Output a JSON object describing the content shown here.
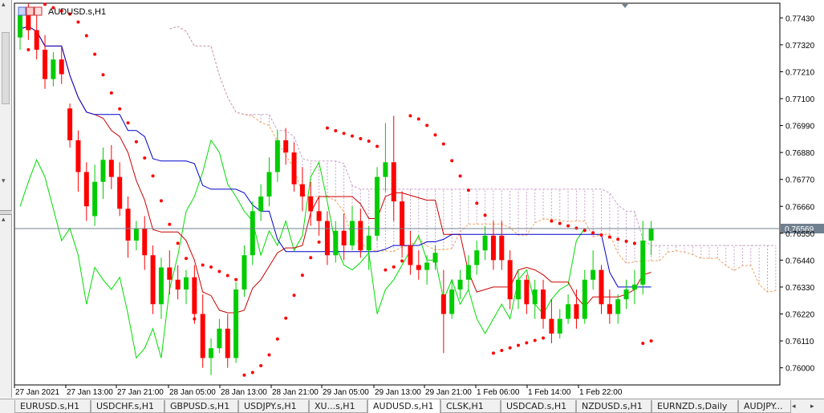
{
  "window": {
    "title": "AUDUSD.s,H1",
    "current_price": "0.76569",
    "marker_icon": "triangle-down-icon"
  },
  "colors": {
    "bull": "#00cc00",
    "bear": "#ff0000",
    "tenkan": "#cc0000",
    "kijun": "#0000cc",
    "chikou": "#00dd00",
    "span_a": "#f4a460",
    "span_b": "#c8a2c8",
    "psar": "#ff0000",
    "price_line": "#708090"
  },
  "price_axis": {
    "labels": [
      "0.77430",
      "0.77320",
      "0.77210",
      "0.77100",
      "0.76990",
      "0.76880",
      "0.76770",
      "0.76660",
      "0.76550",
      "0.76440",
      "0.76330",
      "0.76220",
      "0.76110",
      "0.76000"
    ]
  },
  "time_axis": {
    "labels": [
      "27 Jan 2021",
      "27 Jan 13:00",
      "27 Jan 21:00",
      "28 Jan 05:00",
      "28 Jan 13:00",
      "28 Jan 21:00",
      "29 Jan 05:00",
      "29 Jan 13:00",
      "29 Jan 21:00",
      "1 Feb 06:00",
      "1 Feb 14:00",
      "1 Feb 22:00"
    ]
  },
  "tabs": [
    {
      "label": "EURUSD.s,H1"
    },
    {
      "label": "USDCHF.s,H1"
    },
    {
      "label": "GBPUSD.s,H1"
    },
    {
      "label": "USDJPY.s,H1"
    },
    {
      "label": "XU...s,H1"
    },
    {
      "label": "AUDUSD.s,H1"
    },
    {
      "label": "CLSK,H1"
    },
    {
      "label": "USDCAD.s,H1"
    },
    {
      "label": "NZDUSD.s,H1"
    },
    {
      "label": "EURNZD.s,Daily"
    },
    {
      "label": "AUDJPY..."
    }
  ],
  "tab_nav": {
    "left": "◂",
    "right": "▸"
  },
  "chart_data": {
    "type": "candlestick",
    "symbol": "AUDUSD.s",
    "timeframe": "H1",
    "ylim": [
      0.7593,
      0.7749
    ],
    "last_price": 0.76569,
    "x_labels": [
      "27 Jan 2021",
      "27 Jan 13:00",
      "27 Jan 21:00",
      "28 Jan 05:00",
      "28 Jan 13:00",
      "28 Jan 21:00",
      "29 Jan 05:00",
      "29 Jan 13:00",
      "29 Jan 21:00",
      "1 Feb 06:00",
      "1 Feb 14:00",
      "1 Feb 22:00"
    ],
    "candles": [
      [
        0.7735,
        0.7747,
        0.773,
        0.7744
      ],
      [
        0.7744,
        0.7749,
        0.7734,
        0.7738
      ],
      [
        0.7738,
        0.7746,
        0.7726,
        0.773
      ],
      [
        0.773,
        0.7736,
        0.7714,
        0.7718
      ],
      [
        0.7718,
        0.7729,
        0.7715,
        0.7726
      ],
      [
        0.7726,
        0.7731,
        0.7716,
        0.772
      ],
      [
        0.7706,
        0.7708,
        0.769,
        0.7693
      ],
      [
        0.7693,
        0.7697,
        0.7672,
        0.768
      ],
      [
        0.768,
        0.7684,
        0.766,
        0.7666
      ],
      [
        0.7662,
        0.7683,
        0.7658,
        0.7676
      ],
      [
        0.7676,
        0.769,
        0.7669,
        0.7685
      ],
      [
        0.7685,
        0.7691,
        0.7673,
        0.7678
      ],
      [
        0.7678,
        0.7684,
        0.7662,
        0.7665
      ],
      [
        0.7665,
        0.767,
        0.7645,
        0.7652
      ],
      [
        0.7652,
        0.766,
        0.7648,
        0.7657
      ],
      [
        0.7657,
        0.7662,
        0.764,
        0.7646
      ],
      [
        0.7646,
        0.765,
        0.7622,
        0.7626
      ],
      [
        0.7626,
        0.7645,
        0.762,
        0.7641
      ],
      [
        0.7641,
        0.7648,
        0.763,
        0.7636
      ],
      [
        0.7636,
        0.7642,
        0.7628,
        0.7632
      ],
      [
        0.7632,
        0.764,
        0.7626,
        0.7637
      ],
      [
        0.7637,
        0.7642,
        0.7618,
        0.7622
      ],
      [
        0.7622,
        0.763,
        0.76,
        0.7604
      ],
      [
        0.7604,
        0.7612,
        0.7597,
        0.7608
      ],
      [
        0.7608,
        0.762,
        0.7606,
        0.7616
      ],
      [
        0.7616,
        0.7622,
        0.76,
        0.7604
      ],
      [
        0.7604,
        0.7635,
        0.7602,
        0.7632
      ],
      [
        0.7632,
        0.765,
        0.7629,
        0.7646
      ],
      [
        0.7646,
        0.7668,
        0.7642,
        0.7664
      ],
      [
        0.7664,
        0.7675,
        0.766,
        0.767
      ],
      [
        0.767,
        0.7686,
        0.7666,
        0.768
      ],
      [
        0.768,
        0.7697,
        0.7676,
        0.7693
      ],
      [
        0.7693,
        0.7698,
        0.7683,
        0.7688
      ],
      [
        0.7688,
        0.7692,
        0.7672,
        0.7675
      ],
      [
        0.7675,
        0.7682,
        0.7664,
        0.767
      ],
      [
        0.767,
        0.7676,
        0.7658,
        0.7664
      ],
      [
        0.7664,
        0.767,
        0.7654,
        0.766
      ],
      [
        0.766,
        0.7664,
        0.7642,
        0.7646
      ],
      [
        0.7646,
        0.766,
        0.7643,
        0.7656
      ],
      [
        0.7656,
        0.7663,
        0.7644,
        0.765
      ],
      [
        0.765,
        0.7666,
        0.7648,
        0.766
      ],
      [
        0.766,
        0.7665,
        0.7645,
        0.7648
      ],
      [
        0.7648,
        0.7658,
        0.764,
        0.7654
      ],
      [
        0.7654,
        0.7682,
        0.7652,
        0.7678
      ],
      [
        0.7678,
        0.77,
        0.7672,
        0.7684
      ],
      [
        0.7684,
        0.7703,
        0.766,
        0.7668
      ],
      [
        0.7668,
        0.7672,
        0.7645,
        0.765
      ],
      [
        0.765,
        0.7656,
        0.7638,
        0.7642
      ],
      [
        0.7642,
        0.7648,
        0.7636,
        0.764
      ],
      [
        0.764,
        0.7646,
        0.7634,
        0.7643
      ],
      [
        0.7643,
        0.765,
        0.764,
        0.7647
      ],
      [
        0.763,
        0.764,
        0.7606,
        0.7622
      ],
      [
        0.7622,
        0.7636,
        0.762,
        0.7632
      ],
      [
        0.7632,
        0.764,
        0.7628,
        0.7636
      ],
      [
        0.7636,
        0.7646,
        0.7632,
        0.7642
      ],
      [
        0.7642,
        0.7652,
        0.7638,
        0.7648
      ],
      [
        0.7648,
        0.7658,
        0.7644,
        0.7654
      ],
      [
        0.7654,
        0.766,
        0.764,
        0.7644
      ],
      [
        0.7654,
        0.766,
        0.764,
        0.7644
      ],
      [
        0.7644,
        0.7648,
        0.7624,
        0.7628
      ],
      [
        0.7628,
        0.764,
        0.7624,
        0.7636
      ],
      [
        0.7636,
        0.7638,
        0.7622,
        0.7626
      ],
      [
        0.7626,
        0.7636,
        0.762,
        0.7632
      ],
      [
        0.7632,
        0.7636,
        0.7616,
        0.762
      ],
      [
        0.762,
        0.7628,
        0.761,
        0.7614
      ],
      [
        0.7614,
        0.7624,
        0.7612,
        0.762
      ],
      [
        0.762,
        0.763,
        0.7618,
        0.7626
      ],
      [
        0.7626,
        0.7632,
        0.7616,
        0.762
      ],
      [
        0.762,
        0.764,
        0.7618,
        0.7636
      ],
      [
        0.7636,
        0.7648,
        0.7632,
        0.764
      ],
      [
        0.764,
        0.7642,
        0.7622,
        0.7626
      ],
      [
        0.7626,
        0.7632,
        0.7618,
        0.7622
      ],
      [
        0.7622,
        0.763,
        0.7618,
        0.7628
      ],
      [
        0.7628,
        0.7636,
        0.7624,
        0.7632
      ],
      [
        0.7632,
        0.764,
        0.7626,
        0.7634
      ],
      [
        0.7634,
        0.766,
        0.763,
        0.7652
      ],
      [
        0.7652,
        0.766,
        0.7646,
        0.7657
      ]
    ],
    "indicators": [
      "Ichimoku Kinko Hyo",
      "Parabolic SAR"
    ]
  }
}
